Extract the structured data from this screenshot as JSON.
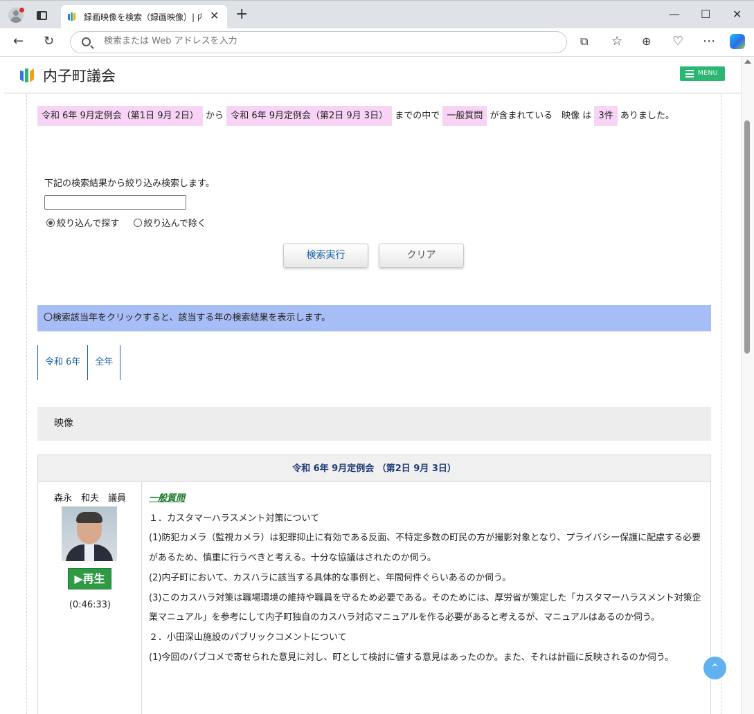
{
  "browser": {
    "tab_title": "録画映像を検索（録画映像）| 内子町議会",
    "address_placeholder": "検索または Web アドレスを入力"
  },
  "site": {
    "title": "内子町議会",
    "menu_label": "MENU"
  },
  "summary": {
    "from": "令和 6年 9月定例会（第1日 9月 2日）",
    "kara": "から",
    "to": "令和 6年 9月定例会（第2日 9月 3日）",
    "made": "までの中で",
    "keyword": "一般質問",
    "contains": "が含まれている　映像 は",
    "count": "3件",
    "tail": "ありました。"
  },
  "refine": {
    "label": "下記の検索結果から絞り込み検索します。",
    "value": "",
    "radio_include": "絞り込んで探す",
    "radio_exclude": "絞り込んで除く",
    "selected": "include",
    "exec_label": "検索実行",
    "clear_label": "クリア"
  },
  "info_text": "〇検索該当年をクリックすると、該当する年の検索結果を表示します。",
  "years": [
    {
      "label": "令和 6年"
    },
    {
      "label": "全年"
    }
  ],
  "video_heading": "映像",
  "result": {
    "title": "令和 6年 9月定例会 （第2日 9月 3日）",
    "speaker": "森永　和夫　議員",
    "play_label": "再生",
    "duration": "(0:46:33)",
    "topic": "一般質問",
    "lines": [
      "１．カスタマーハラスメント対策について",
      "(1)防犯カメラ（監視カメラ）は犯罪抑止に有効である反面、不特定多数の町民の方が撮影対象となり、プライバシー保護に配慮する必要があるため、慎重に行うべきと考える。十分な協議はされたのか伺う。",
      "(2)内子町において、カスハラに該当する具体的な事例と、年間何件ぐらいあるのか伺う。",
      "(3)このカスハラ対策は職場環境の維持や職員を守るため必要である。そのためには、厚労省が策定した「カスタマーハラスメント対策企業マニュアル」を参考にして内子町独自のカスハラ対応マニュアルを作る必要があると考えるが、マニュアルはあるのか伺う。",
      "２．小田深山施設のパブリックコメントについて",
      "(1)今回のパブコメで寄せられた意見に対し、町として検討に値する意見はあったのか。また、それは計画に反映されるのか伺う。"
    ]
  }
}
